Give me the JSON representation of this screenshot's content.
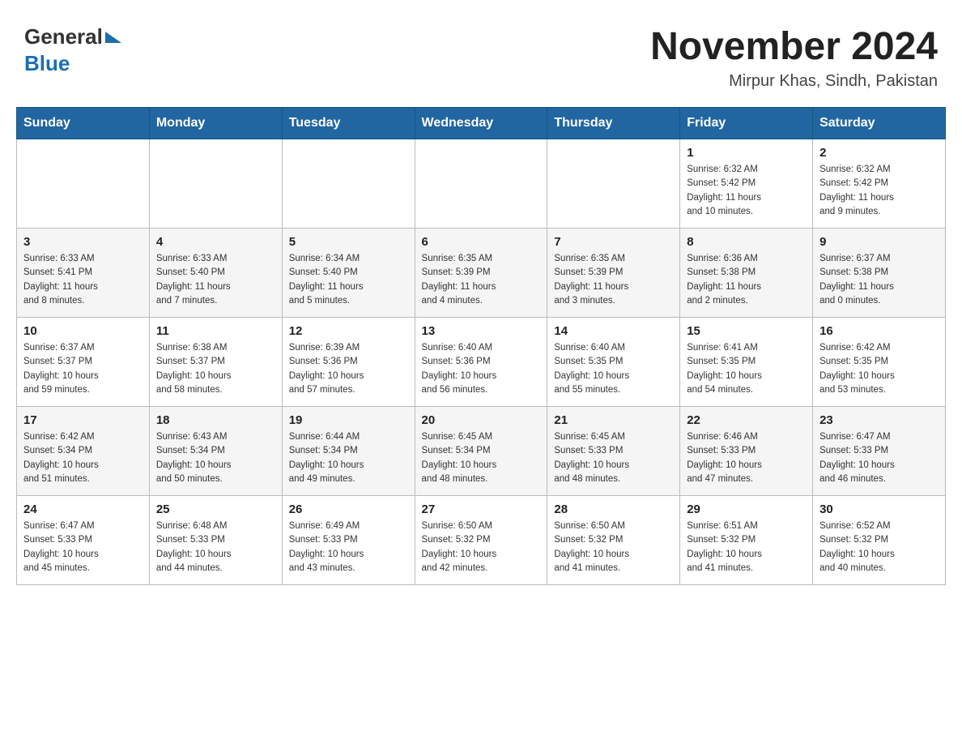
{
  "header": {
    "month_year": "November 2024",
    "location": "Mirpur Khas, Sindh, Pakistan",
    "logo_general": "General",
    "logo_blue": "Blue"
  },
  "days_of_week": [
    "Sunday",
    "Monday",
    "Tuesday",
    "Wednesday",
    "Thursday",
    "Friday",
    "Saturday"
  ],
  "weeks": [
    [
      {
        "day": "",
        "info": ""
      },
      {
        "day": "",
        "info": ""
      },
      {
        "day": "",
        "info": ""
      },
      {
        "day": "",
        "info": ""
      },
      {
        "day": "",
        "info": ""
      },
      {
        "day": "1",
        "info": "Sunrise: 6:32 AM\nSunset: 5:42 PM\nDaylight: 11 hours\nand 10 minutes."
      },
      {
        "day": "2",
        "info": "Sunrise: 6:32 AM\nSunset: 5:42 PM\nDaylight: 11 hours\nand 9 minutes."
      }
    ],
    [
      {
        "day": "3",
        "info": "Sunrise: 6:33 AM\nSunset: 5:41 PM\nDaylight: 11 hours\nand 8 minutes."
      },
      {
        "day": "4",
        "info": "Sunrise: 6:33 AM\nSunset: 5:40 PM\nDaylight: 11 hours\nand 7 minutes."
      },
      {
        "day": "5",
        "info": "Sunrise: 6:34 AM\nSunset: 5:40 PM\nDaylight: 11 hours\nand 5 minutes."
      },
      {
        "day": "6",
        "info": "Sunrise: 6:35 AM\nSunset: 5:39 PM\nDaylight: 11 hours\nand 4 minutes."
      },
      {
        "day": "7",
        "info": "Sunrise: 6:35 AM\nSunset: 5:39 PM\nDaylight: 11 hours\nand 3 minutes."
      },
      {
        "day": "8",
        "info": "Sunrise: 6:36 AM\nSunset: 5:38 PM\nDaylight: 11 hours\nand 2 minutes."
      },
      {
        "day": "9",
        "info": "Sunrise: 6:37 AM\nSunset: 5:38 PM\nDaylight: 11 hours\nand 0 minutes."
      }
    ],
    [
      {
        "day": "10",
        "info": "Sunrise: 6:37 AM\nSunset: 5:37 PM\nDaylight: 10 hours\nand 59 minutes."
      },
      {
        "day": "11",
        "info": "Sunrise: 6:38 AM\nSunset: 5:37 PM\nDaylight: 10 hours\nand 58 minutes."
      },
      {
        "day": "12",
        "info": "Sunrise: 6:39 AM\nSunset: 5:36 PM\nDaylight: 10 hours\nand 57 minutes."
      },
      {
        "day": "13",
        "info": "Sunrise: 6:40 AM\nSunset: 5:36 PM\nDaylight: 10 hours\nand 56 minutes."
      },
      {
        "day": "14",
        "info": "Sunrise: 6:40 AM\nSunset: 5:35 PM\nDaylight: 10 hours\nand 55 minutes."
      },
      {
        "day": "15",
        "info": "Sunrise: 6:41 AM\nSunset: 5:35 PM\nDaylight: 10 hours\nand 54 minutes."
      },
      {
        "day": "16",
        "info": "Sunrise: 6:42 AM\nSunset: 5:35 PM\nDaylight: 10 hours\nand 53 minutes."
      }
    ],
    [
      {
        "day": "17",
        "info": "Sunrise: 6:42 AM\nSunset: 5:34 PM\nDaylight: 10 hours\nand 51 minutes."
      },
      {
        "day": "18",
        "info": "Sunrise: 6:43 AM\nSunset: 5:34 PM\nDaylight: 10 hours\nand 50 minutes."
      },
      {
        "day": "19",
        "info": "Sunrise: 6:44 AM\nSunset: 5:34 PM\nDaylight: 10 hours\nand 49 minutes."
      },
      {
        "day": "20",
        "info": "Sunrise: 6:45 AM\nSunset: 5:34 PM\nDaylight: 10 hours\nand 48 minutes."
      },
      {
        "day": "21",
        "info": "Sunrise: 6:45 AM\nSunset: 5:33 PM\nDaylight: 10 hours\nand 48 minutes."
      },
      {
        "day": "22",
        "info": "Sunrise: 6:46 AM\nSunset: 5:33 PM\nDaylight: 10 hours\nand 47 minutes."
      },
      {
        "day": "23",
        "info": "Sunrise: 6:47 AM\nSunset: 5:33 PM\nDaylight: 10 hours\nand 46 minutes."
      }
    ],
    [
      {
        "day": "24",
        "info": "Sunrise: 6:47 AM\nSunset: 5:33 PM\nDaylight: 10 hours\nand 45 minutes."
      },
      {
        "day": "25",
        "info": "Sunrise: 6:48 AM\nSunset: 5:33 PM\nDaylight: 10 hours\nand 44 minutes."
      },
      {
        "day": "26",
        "info": "Sunrise: 6:49 AM\nSunset: 5:33 PM\nDaylight: 10 hours\nand 43 minutes."
      },
      {
        "day": "27",
        "info": "Sunrise: 6:50 AM\nSunset: 5:32 PM\nDaylight: 10 hours\nand 42 minutes."
      },
      {
        "day": "28",
        "info": "Sunrise: 6:50 AM\nSunset: 5:32 PM\nDaylight: 10 hours\nand 41 minutes."
      },
      {
        "day": "29",
        "info": "Sunrise: 6:51 AM\nSunset: 5:32 PM\nDaylight: 10 hours\nand 41 minutes."
      },
      {
        "day": "30",
        "info": "Sunrise: 6:52 AM\nSunset: 5:32 PM\nDaylight: 10 hours\nand 40 minutes."
      }
    ]
  ]
}
